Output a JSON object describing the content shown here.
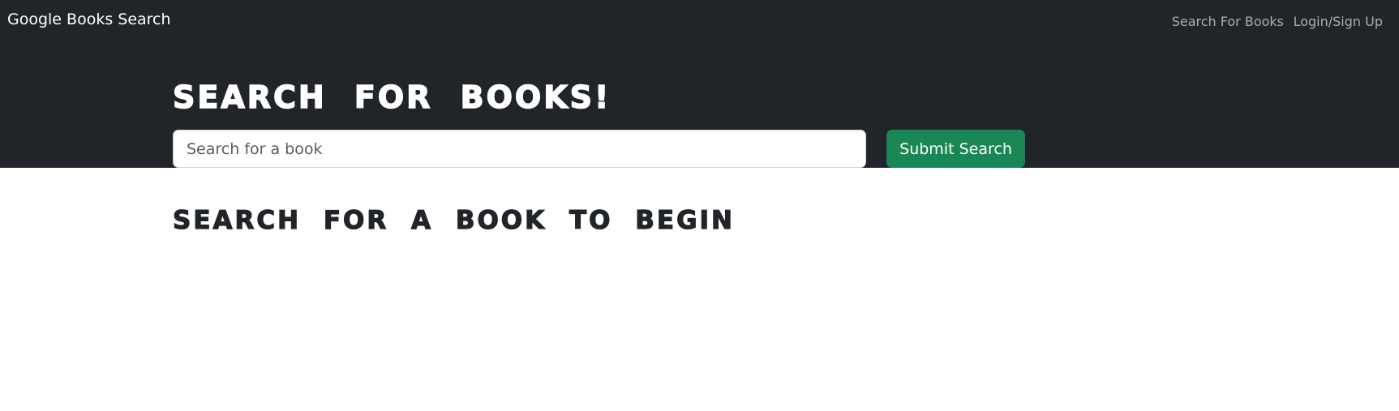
{
  "navbar": {
    "brand": "Google Books Search",
    "links": [
      {
        "label": "Search For Books"
      },
      {
        "label": "Login/Sign Up"
      }
    ]
  },
  "hero": {
    "title": "Search for Books!",
    "search_placeholder": "Search for a book",
    "search_value": "",
    "submit_label": "Submit Search"
  },
  "results": {
    "heading": "Search for a book to begin"
  },
  "colors": {
    "navbar_bg": "#212529",
    "submit_bg": "#198754",
    "heading_text": "#212529"
  }
}
